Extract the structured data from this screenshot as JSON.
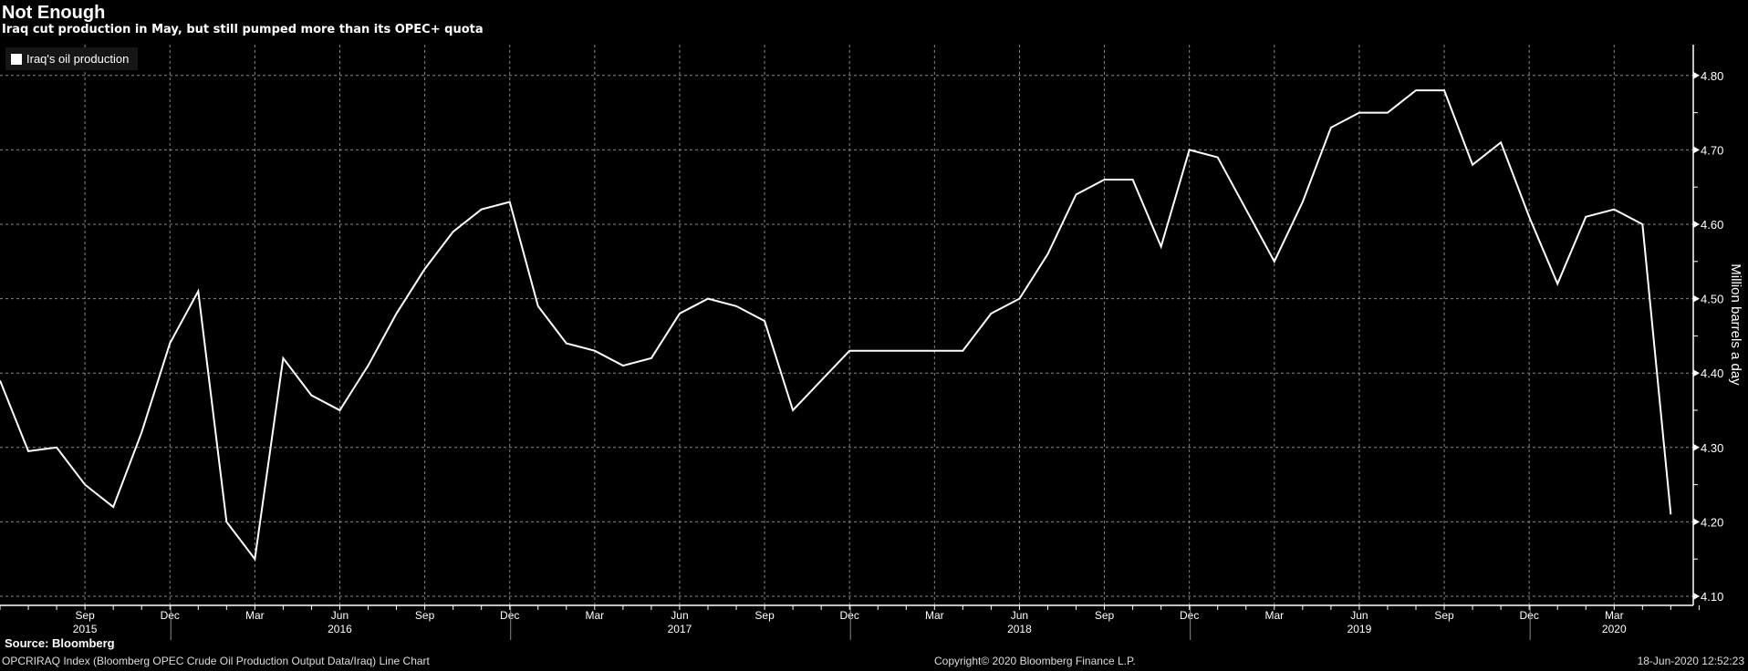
{
  "chart_data": {
    "type": "line",
    "title": "Not Enough",
    "subtitle": "Iraq cut production in May, but still pumped more than its OPEC+ quota",
    "ylabel": "Million barrels a day",
    "ylim": [
      4.1,
      4.85
    ],
    "yticks": [
      "4.10",
      "4.20",
      "4.30",
      "4.40",
      "4.50",
      "4.60",
      "4.70",
      "4.80"
    ],
    "legend": {
      "position": "top-left",
      "entries": [
        "Iraq's oil production"
      ]
    },
    "x_start": "Jun 2015",
    "month_ticks": [
      {
        "i": 3,
        "label": "Sep"
      },
      {
        "i": 6,
        "label": "Dec"
      },
      {
        "i": 9,
        "label": "Mar"
      },
      {
        "i": 12,
        "label": "Jun"
      },
      {
        "i": 15,
        "label": "Sep"
      },
      {
        "i": 18,
        "label": "Dec"
      },
      {
        "i": 21,
        "label": "Mar"
      },
      {
        "i": 24,
        "label": "Jun"
      },
      {
        "i": 27,
        "label": "Sep"
      },
      {
        "i": 30,
        "label": "Dec"
      },
      {
        "i": 33,
        "label": "Mar"
      },
      {
        "i": 36,
        "label": "Jun"
      },
      {
        "i": 39,
        "label": "Sep"
      },
      {
        "i": 42,
        "label": "Dec"
      },
      {
        "i": 45,
        "label": "Mar"
      },
      {
        "i": 48,
        "label": "Jun"
      },
      {
        "i": 51,
        "label": "Sep"
      },
      {
        "i": 54,
        "label": "Dec"
      },
      {
        "i": 57,
        "label": "Mar"
      }
    ],
    "year_labels": [
      {
        "i": 3,
        "label": "2015"
      },
      {
        "i": 12,
        "label": "2016"
      },
      {
        "i": 24,
        "label": "2017"
      },
      {
        "i": 36,
        "label": "2018"
      },
      {
        "i": 48,
        "label": "2019"
      },
      {
        "i": 57,
        "label": "2020"
      }
    ],
    "series": [
      {
        "name": "Iraq's oil production",
        "color": "#ffffff",
        "values": [
          4.39,
          4.295,
          4.3,
          4.25,
          4.22,
          4.32,
          4.44,
          4.51,
          4.2,
          4.15,
          4.42,
          4.37,
          4.35,
          4.41,
          4.48,
          4.54,
          4.59,
          4.62,
          4.63,
          4.49,
          4.44,
          4.43,
          4.41,
          4.42,
          4.48,
          4.5,
          4.49,
          4.47,
          4.35,
          4.39,
          4.43,
          4.43,
          4.43,
          4.43,
          4.43,
          4.48,
          4.5,
          4.56,
          4.64,
          4.66,
          4.66,
          4.57,
          4.7,
          4.69,
          4.62,
          4.55,
          4.63,
          4.73,
          4.75,
          4.75,
          4.78,
          4.78,
          4.68,
          4.71,
          4.61,
          4.52,
          4.61,
          4.62,
          4.6,
          4.21
        ]
      }
    ]
  },
  "footer": {
    "source": "Source: Bloomberg",
    "left": "OPCRIRAQ Index (Bloomberg OPEC Crude Oil Production Output Data/Iraq) Line Chart",
    "center": "Copyright© 2020 Bloomberg Finance L.P.",
    "right": "18-Jun-2020 12:52:23"
  }
}
